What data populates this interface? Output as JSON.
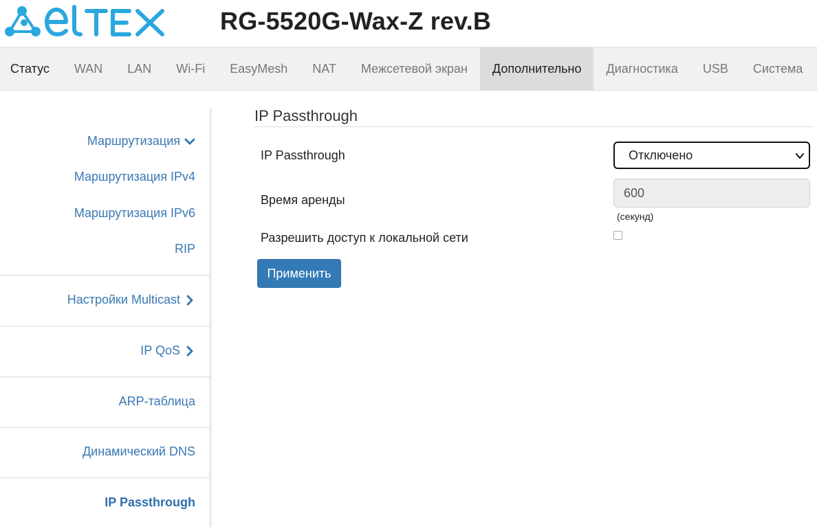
{
  "brand": {
    "logo_text": "ELTEX",
    "color": "#2aa7df"
  },
  "header": {
    "model": "RG-5520G-Wax-Z rev.B"
  },
  "topnav": {
    "items": [
      {
        "label": "Статус"
      },
      {
        "label": "WAN"
      },
      {
        "label": "LAN"
      },
      {
        "label": "Wi-Fi"
      },
      {
        "label": "EasyMesh"
      },
      {
        "label": "NAT"
      },
      {
        "label": "Межсетевой экран"
      },
      {
        "label": "Дополнительно",
        "active": true
      },
      {
        "label": "Диагностика"
      },
      {
        "label": "USB"
      },
      {
        "label": "Система"
      }
    ]
  },
  "sidebar": {
    "routing": {
      "label": "Маршрутизация",
      "icon": "chevron-down-icon"
    },
    "routing_ipv4": "Маршрутизация IPv4",
    "routing_ipv6": "Маршрутизация IPv6",
    "rip": "RIP",
    "multicast": {
      "label": "Настройки Multicast",
      "icon": "chevron-right-icon"
    },
    "ipqos": {
      "label": "IP QoS",
      "icon": "chevron-right-icon"
    },
    "arp": "ARP-таблица",
    "ddns": "Динамический DNS",
    "passthrough": "IP Passthrough"
  },
  "main": {
    "title": "IP Passthrough",
    "fields": {
      "mode_label": "IP Passthrough",
      "mode_value": "Отключено",
      "lease_label": "Время аренды",
      "lease_value": "600",
      "lease_units": "(секунд)",
      "lan_access_label": "Разрешить доступ к локальной сети",
      "lan_access_checked": false
    },
    "apply_button": "Применить"
  },
  "colors": {
    "link": "#3a78b4",
    "button": "#337ab7",
    "nav_bg": "#f1f1f1",
    "nav_active": "#dcdcdc"
  }
}
